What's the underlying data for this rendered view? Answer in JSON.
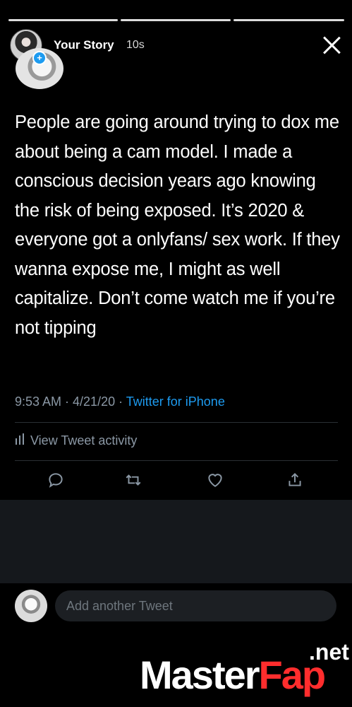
{
  "story": {
    "title": "Your Story",
    "time": "10s",
    "progress_segments": [
      1,
      1,
      0.85
    ]
  },
  "tweet": {
    "text": "People are going around trying to dox me about being a cam model. I made a conscious decision years ago knowing the risk of being exposed. It’s 2020 & everyone got a onlyfans/ sex work. If they wanna expose me, I might as well capitalize. Don’t come watch me if you’re not tipping",
    "time": "9:53 AM · 4/21/20 · ",
    "source": "Twitter for iPhone",
    "activity_label": "View Tweet activity"
  },
  "actions": [
    "reply-icon",
    "retweet-icon",
    "like-icon",
    "share-icon"
  ],
  "compose": {
    "placeholder": "Add another Tweet"
  },
  "watermark": {
    "part1": "Master",
    "part2": "Fap",
    "tld": ".net"
  },
  "colors": {
    "background": "#000000",
    "accent": "#1d9bf0",
    "muted": "#8b98a5",
    "watermark_red": "#ff2d2d"
  }
}
